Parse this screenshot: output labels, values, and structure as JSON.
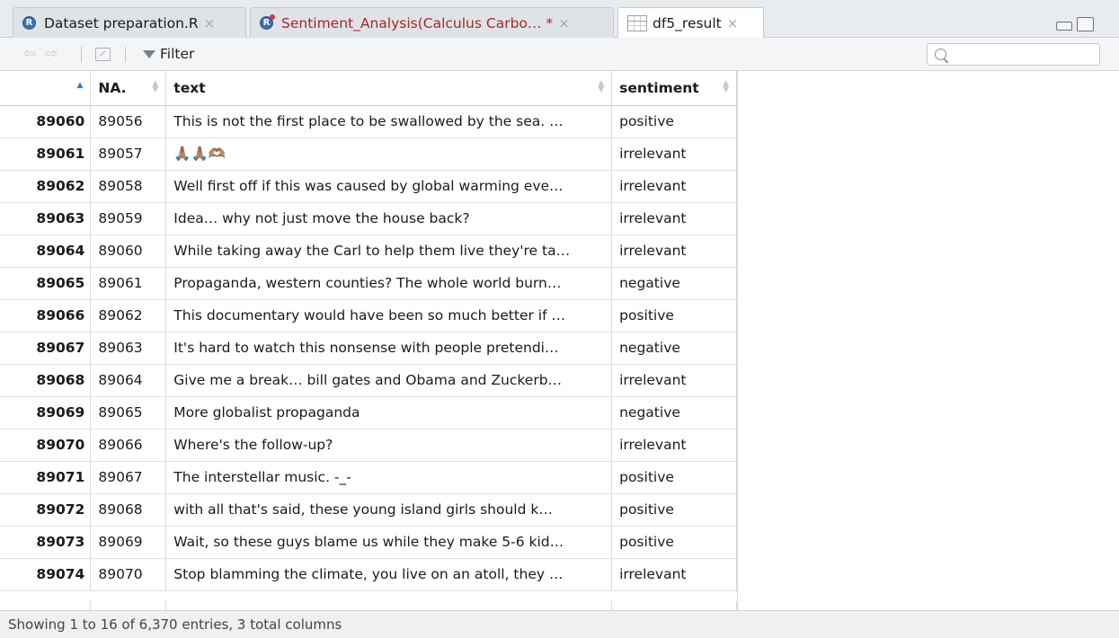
{
  "tabs": [
    {
      "label": "Dataset preparation.R",
      "close": "×",
      "icon": "r-file-icon"
    },
    {
      "label": "Sentiment_Analysis(Calculus Carbo… *",
      "close": "×",
      "icon": "r-file-icon"
    },
    {
      "label": "df5_result",
      "close": "×",
      "icon": "data-grid-icon"
    }
  ],
  "toolbar": {
    "back_glyph": "⇦",
    "forward_glyph": "⇨",
    "filter_label": "Filter",
    "search_placeholder": ""
  },
  "table": {
    "columns": [
      "",
      "NA.",
      "text",
      "sentiment"
    ],
    "rows": [
      {
        "idx": "89060",
        "na": "89056",
        "text": "This is not the first place to be swallowed by the sea. …",
        "sentiment": "positive"
      },
      {
        "idx": "89061",
        "na": "89057",
        "text": "🙏🏽🙏🏽🫶🏽",
        "sentiment": "irrelevant"
      },
      {
        "idx": "89062",
        "na": "89058",
        "text": "Well first off if this was caused by global warming eve…",
        "sentiment": "irrelevant"
      },
      {
        "idx": "89063",
        "na": "89059",
        "text": "Idea… why not just move the house back?",
        "sentiment": "irrelevant"
      },
      {
        "idx": "89064",
        "na": "89060",
        "text": "While taking away the Carl to help them live they're ta…",
        "sentiment": "irrelevant"
      },
      {
        "idx": "89065",
        "na": "89061",
        "text": "Propaganda, western counties? The whole world burn…",
        "sentiment": "negative"
      },
      {
        "idx": "89066",
        "na": "89062",
        "text": "This documentary would have been so much better if …",
        "sentiment": "positive"
      },
      {
        "idx": "89067",
        "na": "89063",
        "text": "It's hard to watch this nonsense with people pretendi…",
        "sentiment": "negative"
      },
      {
        "idx": "89068",
        "na": "89064",
        "text": "Give me a break… bill gates and Obama and Zuckerb…",
        "sentiment": "irrelevant"
      },
      {
        "idx": "89069",
        "na": "89065",
        "text": "More globalist propaganda",
        "sentiment": "negative"
      },
      {
        "idx": "89070",
        "na": "89066",
        "text": "Where's the follow-up?",
        "sentiment": "irrelevant"
      },
      {
        "idx": "89071",
        "na": "89067",
        "text": "The interstellar music. -_-",
        "sentiment": "positive"
      },
      {
        "idx": "89072",
        "na": "89068",
        "text": "with all that's said,  these young island girls should k…",
        "sentiment": "positive"
      },
      {
        "idx": "89073",
        "na": "89069",
        "text": "Wait, so these guys blame us while they make 5-6 kid…",
        "sentiment": "positive"
      },
      {
        "idx": "89074",
        "na": "89070",
        "text": "Stop blamming the climate, you live on an atoll, they …",
        "sentiment": "irrelevant"
      }
    ]
  },
  "status": {
    "text": "Showing 1 to 16 of 6,370 entries, 3 total columns"
  }
}
